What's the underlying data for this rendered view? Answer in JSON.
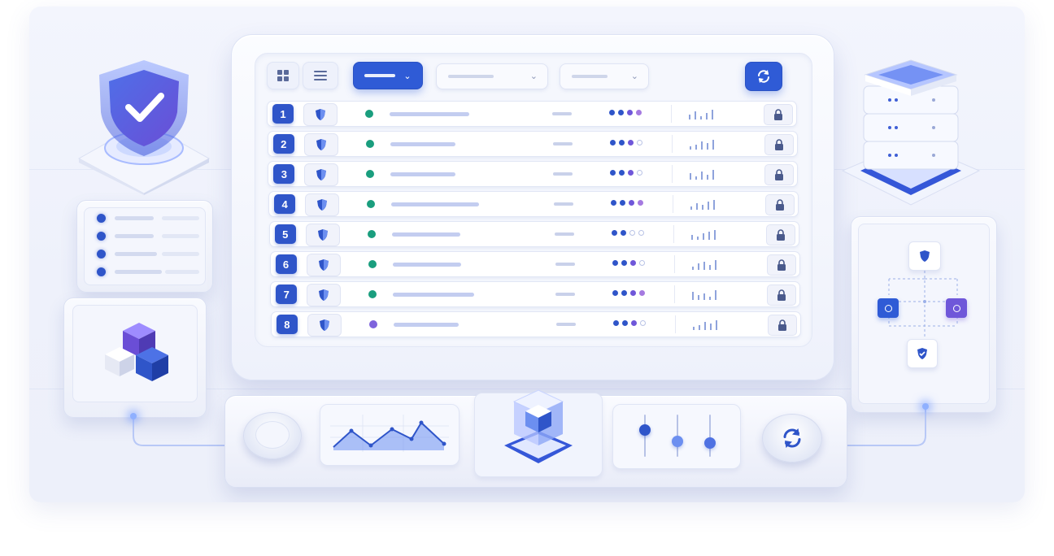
{
  "rows": [
    {
      "num": "1",
      "status_color": "#1a9e7e",
      "name_w": 98,
      "pips": [
        "#2f55c9",
        "#2f55c9",
        "#6f57d9",
        "#a57ae0"
      ]
    },
    {
      "num": "2",
      "status_color": "#1a9e7e",
      "name_w": 80,
      "pips": [
        "#2f55c9",
        "#2f55c9",
        "#6f57d9",
        "#b9c3e6"
      ]
    },
    {
      "num": "3",
      "status_color": "#1a9e7e",
      "name_w": 80,
      "pips": [
        "#2f55c9",
        "#2f55c9",
        "#6f57d9",
        "#b9c3e6"
      ]
    },
    {
      "num": "4",
      "status_color": "#1a9e7e",
      "name_w": 108,
      "pips": [
        "#2f55c9",
        "#2f55c9",
        "#6f57d9",
        "#a57ae0"
      ]
    },
    {
      "num": "5",
      "status_color": "#1a9e7e",
      "name_w": 84,
      "pips": [
        "#2f55c9",
        "#2f55c9",
        "#b9c3e6",
        "#b9c3e6"
      ]
    },
    {
      "num": "6",
      "status_color": "#1a9e7e",
      "name_w": 84,
      "pips": [
        "#2f55c9",
        "#2f55c9",
        "#6f57d9",
        "#b9c3e6"
      ]
    },
    {
      "num": "7",
      "status_color": "#1a9e7e",
      "name_w": 100,
      "pips": [
        "#2f55c9",
        "#2f55c9",
        "#6f57d9",
        "#a57ae0"
      ]
    },
    {
      "num": "8",
      "status_color": "#7e63dc",
      "name_w": 80,
      "pips": [
        "#2f55c9",
        "#2f55c9",
        "#6f57d9",
        "#b9c3e6"
      ]
    }
  ],
  "colors": {
    "accent": "#2f55c9",
    "accent_bright": "#2f5bd6",
    "purple": "#6f57d9",
    "teal": "#1a9e7e"
  }
}
